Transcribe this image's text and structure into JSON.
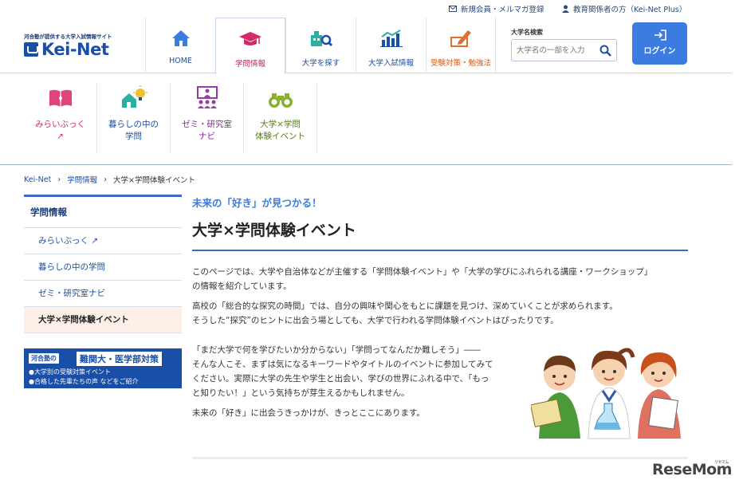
{
  "utility": {
    "register": "新規会員・メルマガ登録",
    "teachers": "教育関係者の方（Kei-Net Plus）"
  },
  "header": {
    "tagline": "河合塾が提供する大学入試情報サイト",
    "logo_text": "Kei-Net",
    "nav": [
      {
        "label": "HOME",
        "icon": "house-icon"
      },
      {
        "label": "学問情報",
        "icon": "mortarboard-icon"
      },
      {
        "label": "大学を探す",
        "icon": "building-search-icon"
      },
      {
        "label": "大学入試情報",
        "icon": "bar-chart-icon"
      },
      {
        "label": "受験対策・勉強法",
        "icon": "pencil-icon"
      }
    ],
    "search_label": "大学名検索",
    "search_placeholder": "大学名の一部を入力",
    "login_label": "ログイン"
  },
  "subnav": [
    {
      "line1": "みらいぶっく",
      "line2": "↗",
      "icon": "book-icon"
    },
    {
      "line1": "暮らしの中の",
      "line2": "学問",
      "icon": "house-lightbulb-icon"
    },
    {
      "line1": "ゼミ・研究室",
      "line2": "ナビ",
      "icon": "seminar-icon"
    },
    {
      "line1": "大学×学問",
      "line2": "体験イベント",
      "icon": "binoculars-icon"
    }
  ],
  "breadcrumb": [
    "Kei-Net",
    "学問情報",
    "大学×学問体験イベント"
  ],
  "sidebar": {
    "heading": "学問情報",
    "items": [
      "みらいぶっく",
      "暮らしの中の学問",
      "ゼミ・研究室ナビ",
      "大学×学問体験イベント"
    ],
    "banner": {
      "tag": "河合塾の",
      "title": "難関大・医学部対策",
      "line1": "●大学別の受験対策イベント",
      "line2": "●合格した先輩たちの声 などをご紹介"
    }
  },
  "main": {
    "catch": "未来の「好き」が見つかる！",
    "title": "大学×学問体験イベント",
    "p1a": "このページでは、大学や自治体などが主催する「学問体験イベント」や「大学の学びにふれられる講座・ワークショップ」",
    "p1b": "の情報を紹介しています。",
    "p2a": "高校の「総合的な探究の時間」では、自分の興味や関心をもとに課題を見つけ、深めていくことが求められます。",
    "p2b": "そうした“探究”のヒントに出会う場としても、大学で行われる学問体験イベントはぴったりです。",
    "p3a": "「まだ大学で何を学びたいか分からない」「学問ってなんだか難しそう」――",
    "p3b": "そんな人こそ、まずは気になるキーワードやタイトルのイベントに参加してみて",
    "p3c": "ください。実際に大学の先生や学生と出会い、学びの世界にふれる中で、「もっ",
    "p3d": "と知りたい！」という気持ちが芽生えるかもしれません。",
    "p4": "未来の「好き」に出会うきっかけが、きっとここにあります。"
  },
  "watermark": {
    "text": "ReseMom",
    "small": "リセマム"
  }
}
